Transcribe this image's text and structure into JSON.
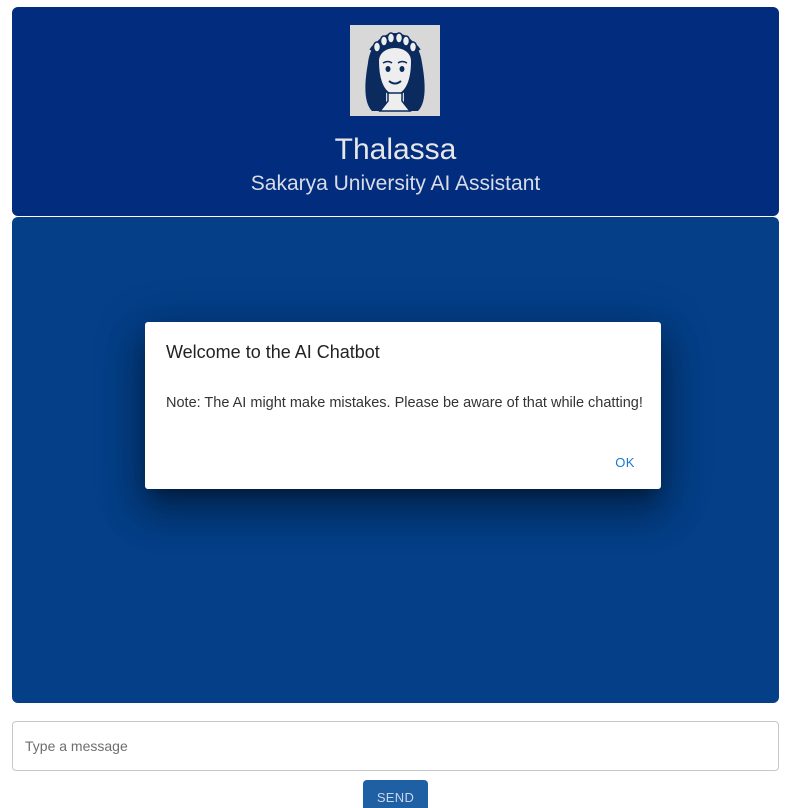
{
  "header": {
    "bot_name": "Thalassa",
    "subtitle": "Sakarya University AI Assistant",
    "avatar_icon": "woman-with-laurel-wreath-icon"
  },
  "chat": {
    "input_placeholder": "Type a message",
    "send_label": "SEND"
  },
  "dialog": {
    "title": "Welcome to the AI Chatbot",
    "message": "Note: The AI might make mistakes. Please be aware of that while chatting!",
    "ok_label": "OK"
  },
  "colors": {
    "header_bg": "#022c7d",
    "chat_bg": "#043f88",
    "send_button": "#1f5fa4",
    "dialog_button": "#1976d2"
  }
}
